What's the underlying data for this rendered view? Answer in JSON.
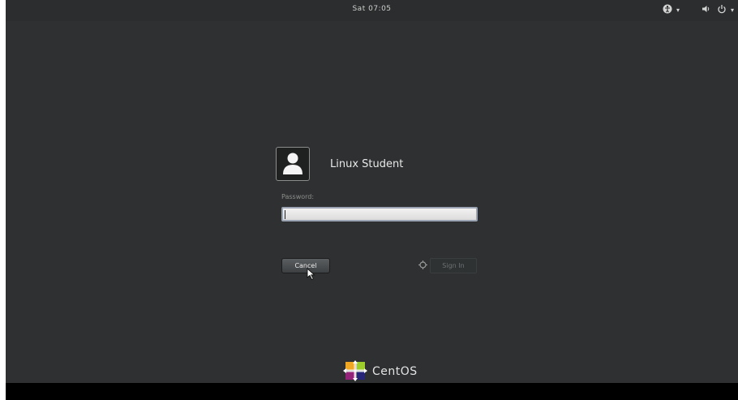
{
  "topbar": {
    "clock": "Sat 07:05",
    "tray": {
      "accessibility_icon": "accessibility-icon",
      "accessibility_arrow": "▾",
      "volume_icon": "volume-icon",
      "power_icon": "power-icon",
      "power_arrow": "▾"
    }
  },
  "login": {
    "avatar_icon": "user-avatar-icon",
    "user_name": "Linux Student",
    "password_label": "Password:",
    "password_value": "",
    "cancel_label": "Cancel",
    "spinner_icon": "spinner-icon",
    "signin_label": "Sign In"
  },
  "branding": {
    "logo_icon": "centos-logo-icon",
    "name": "CentOS"
  },
  "colors": {
    "background": "#2e3031",
    "topbar": "#2b2d2e",
    "field_border": "#9aa4b2",
    "bottom_strip": "#000000"
  }
}
